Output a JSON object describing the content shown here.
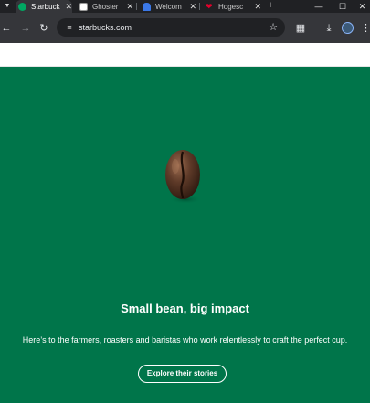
{
  "browser": {
    "tabs": [
      {
        "label": "Starbuck",
        "active": true,
        "favicon": "starbucks-logo-icon",
        "favicon_color": "#00a862"
      },
      {
        "label": "Ghoster",
        "active": false,
        "favicon": "ghostery-logo-icon",
        "favicon_color": "#ffffff"
      },
      {
        "label": "Welcom",
        "active": false,
        "favicon": "ghost-logo-icon",
        "favicon_color": "#3b78e7"
      },
      {
        "label": "Hogesc",
        "active": false,
        "favicon": "heart-logo-icon",
        "favicon_color": "#e4002b"
      }
    ],
    "address": "starbucks.com"
  },
  "hero": {
    "background_color": "#00754a",
    "title": "Small bean, big impact",
    "subtitle": "Here’s to the farmers, roasters and baristas who work relentlessly to craft the perfect cup.",
    "cta_label": "Explore their stories",
    "image": "coffee-bean-image"
  }
}
